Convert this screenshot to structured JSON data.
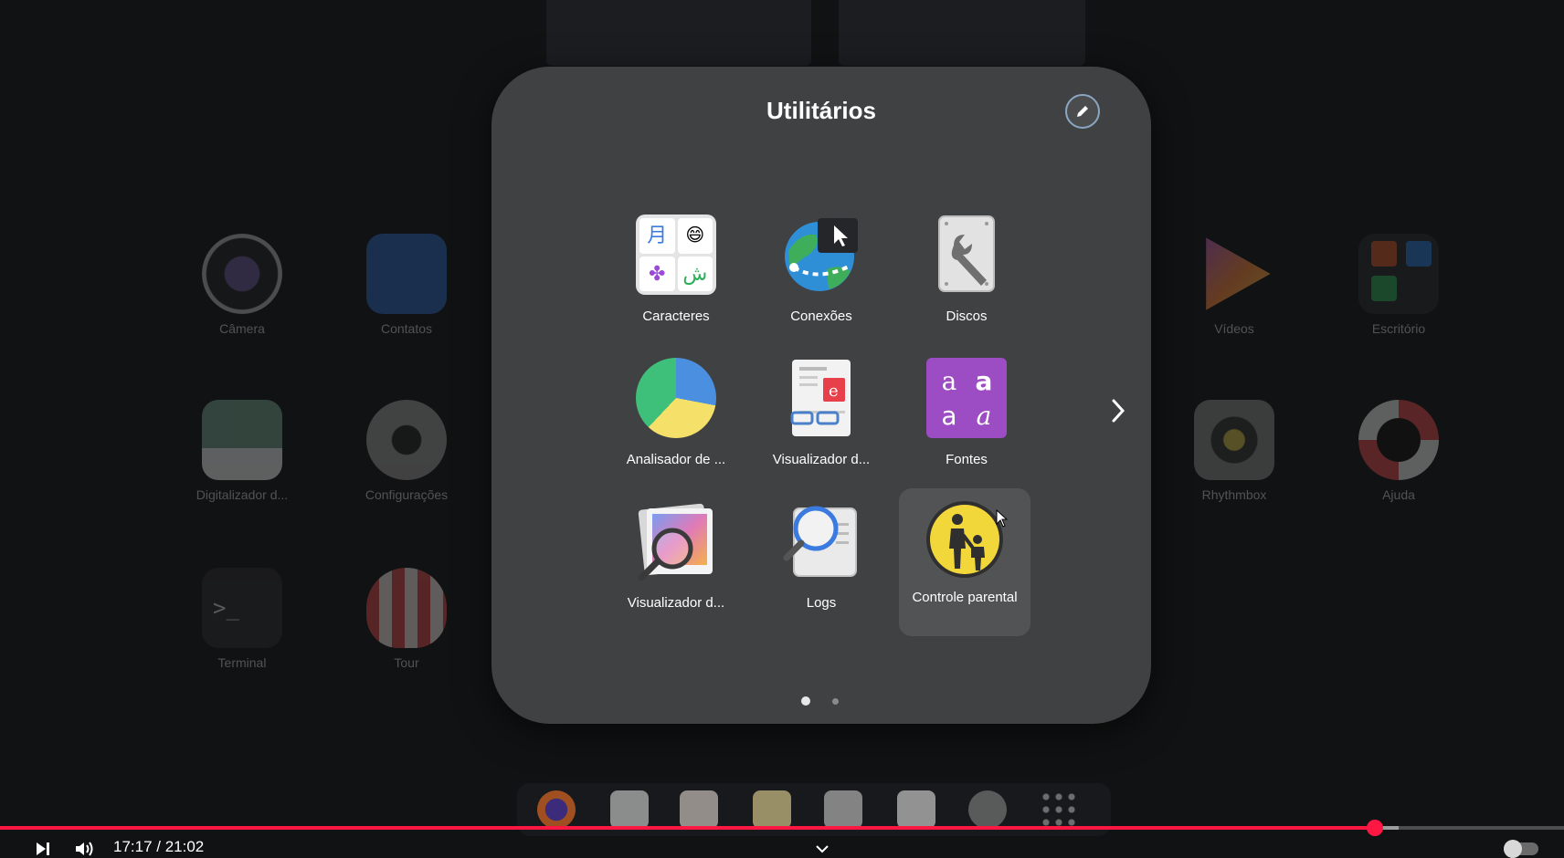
{
  "background": {
    "apps": [
      {
        "label": "Câmera",
        "icon": "camera-icon"
      },
      {
        "label": "Contatos",
        "icon": "contacts-icon"
      },
      {
        "label": "Digitalizador d...",
        "icon": "scanner-icon"
      },
      {
        "label": "Configurações",
        "icon": "settings-icon"
      },
      {
        "label": "Terminal",
        "icon": "terminal-icon"
      },
      {
        "label": "Tour",
        "icon": "tour-icon"
      },
      {
        "label": "Vídeos",
        "icon": "videos-icon"
      },
      {
        "label": "Escritório",
        "icon": "office-folder-icon"
      },
      {
        "label": "Rhythmbox",
        "icon": "rhythmbox-icon"
      },
      {
        "label": "Ajuda",
        "icon": "help-icon"
      }
    ],
    "terminal_prompt": ">_"
  },
  "folder": {
    "title": "Utilitários",
    "apps": [
      {
        "label": "Caracteres",
        "icon": "characters-icon"
      },
      {
        "label": "Conexões",
        "icon": "connections-icon"
      },
      {
        "label": "Discos",
        "icon": "disks-icon"
      },
      {
        "label": "Analisador de ...",
        "icon": "disk-usage-analyzer-icon"
      },
      {
        "label": "Visualizador d...",
        "icon": "document-viewer-icon"
      },
      {
        "label": "Fontes",
        "icon": "fonts-icon"
      },
      {
        "label": "Visualizador d...",
        "icon": "image-viewer-icon"
      },
      {
        "label": "Logs",
        "icon": "logs-icon"
      },
      {
        "label": "Controle parental",
        "icon": "parental-controls-icon"
      }
    ],
    "characters_glyphs": [
      "月",
      "😄",
      "✤",
      "ش"
    ],
    "fonts_glyphs": [
      "a",
      "a",
      "a",
      "a"
    ],
    "pages": 2,
    "current_page": 1
  },
  "player": {
    "current_time": "17:17",
    "duration": "21:02",
    "time_display": "17:17 / 21:02",
    "progress_percent": 87.9,
    "buffer_percent": 89.4,
    "accent": "#ff1744"
  }
}
